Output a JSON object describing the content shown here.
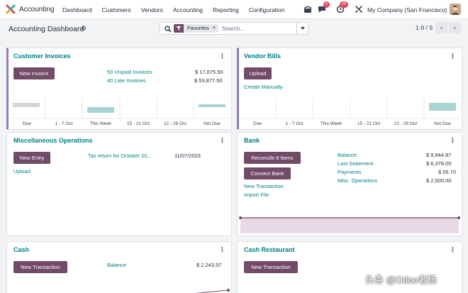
{
  "navbar": {
    "app_name": "Accounting",
    "menu": [
      "Dashboard",
      "Customers",
      "Vendors",
      "Accounting",
      "Reporting",
      "Configuration"
    ],
    "messages_badge": "6",
    "activities_badge": "28",
    "company": "My Company (San Francisco)"
  },
  "control_panel": {
    "title": "Accounting Dashboard",
    "facet": "Favorites",
    "facet_remove": "×",
    "search_placeholder": "Search...",
    "pager": "1-9 / 9"
  },
  "cards": {
    "customer_invoices": {
      "title": "Customer Invoices",
      "button": "New Invoice",
      "rows": [
        {
          "label": "50 Unpaid Invoices",
          "value": "$ 17,675.50"
        },
        {
          "label": "40 Late Invoices",
          "value": "$ 53,877.50"
        }
      ],
      "axis": [
        "Due",
        "1 - 7 Oct",
        "This Week",
        "15 - 21 Oct",
        "22 - 28 Oct",
        "Not Due"
      ]
    },
    "vendor_bills": {
      "title": "Vendor Bills",
      "button": "Upload",
      "link": "Create Manually",
      "axis": [
        "Due",
        "1 - 7 Oct",
        "This Week",
        "15 - 21 Oct",
        "22 - 28 Oct",
        "Not Due"
      ]
    },
    "misc": {
      "title": "Miscellaneous Operations",
      "button": "New Entry",
      "link": "Upload",
      "task": "Tax return for October 20...",
      "date": "11/07/2023"
    },
    "bank": {
      "title": "Bank",
      "reconcile_button": "Reconcile 8 Items",
      "connect_button": "Connect Bank",
      "links": [
        "New Transaction",
        "Import File"
      ],
      "rows": [
        {
          "label": "Balance",
          "value": "$ 9,944.87"
        },
        {
          "label": "Last Statement",
          "value": "$ 6,378.00"
        },
        {
          "label": "Payments",
          "value": "$ 55.70"
        },
        {
          "label": "Misc. Operations",
          "value": "$ 2,500.00"
        }
      ]
    },
    "cash": {
      "title": "Cash",
      "button": "New Transaction",
      "balance_label": "Balance",
      "balance_value": "$ 2,243.57"
    },
    "cash_restaurant": {
      "title": "Cash Restaurant",
      "button": "New Transaction"
    }
  },
  "colors": {
    "primary": "#714b67",
    "link": "#017e84",
    "bar_past": "#d6d6d6",
    "bar_future": "#a8d5d3"
  },
  "watermark": "头条 @Odoo老杨"
}
